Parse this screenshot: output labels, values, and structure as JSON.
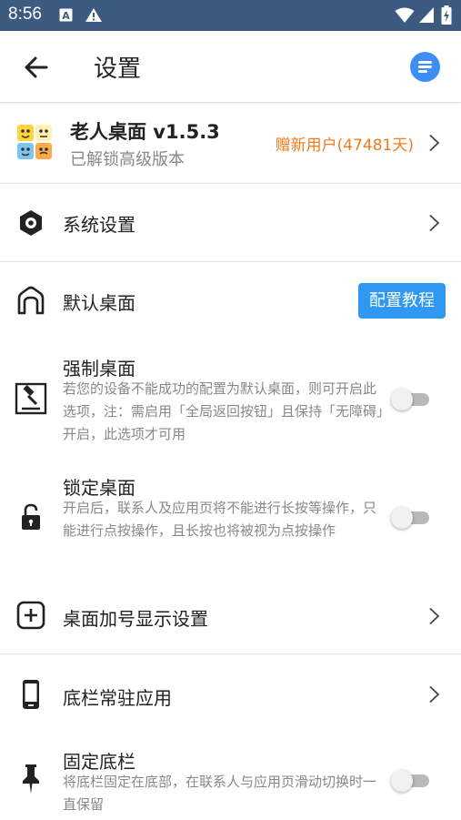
{
  "status_bar": {
    "time": "8:56"
  },
  "app_bar": {
    "title": "设置"
  },
  "app_info": {
    "name": "老人桌面 v1.5.3",
    "status": "已解锁高级版本",
    "vip": "赠新用户(47481天)"
  },
  "settings": {
    "system": {
      "label": "系统设置"
    },
    "default_launcher": {
      "label": "默认桌面",
      "button": "配置教程"
    },
    "force_launcher": {
      "label": "强制桌面",
      "desc": "若您的设备不能成功的配置为默认桌面，则可开启此选项，注：需启用「全局返回按钮」且保持「无障碍」开启，此选项才可用",
      "enabled": false
    },
    "lock_launcher": {
      "label": "锁定桌面",
      "desc": "开启后，联系人及应用页将不能进行长按等操作，只能进行点按操作，且长按也将被视为点按操作",
      "enabled": false
    },
    "plus_display": {
      "label": "桌面加号显示设置"
    },
    "dock_apps": {
      "label": "底栏常驻应用"
    },
    "fixed_dock": {
      "label": "固定底栏",
      "desc": "将底栏固定在底部，在联系人与应用页滑动切换时一直保留",
      "enabled": false
    }
  }
}
